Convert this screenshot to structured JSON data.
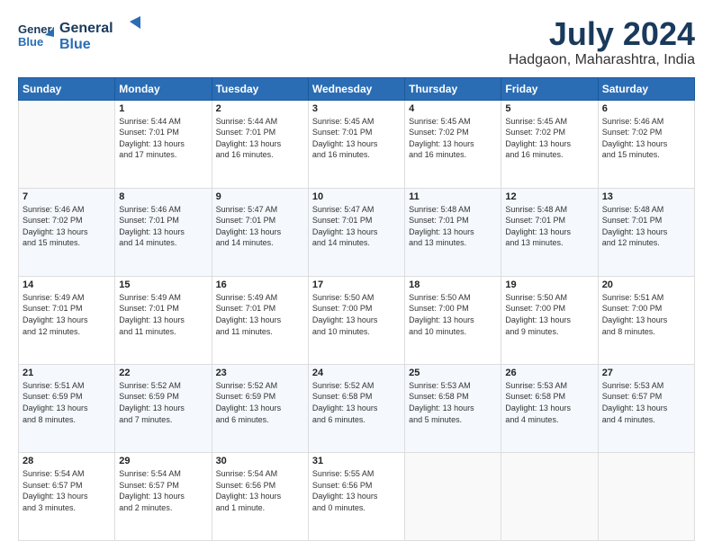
{
  "header": {
    "logo": {
      "line1": "General",
      "line2": "Blue"
    },
    "title": "July 2024",
    "location": "Hadgaon, Maharashtra, India"
  },
  "days_of_week": [
    "Sunday",
    "Monday",
    "Tuesday",
    "Wednesday",
    "Thursday",
    "Friday",
    "Saturday"
  ],
  "weeks": [
    [
      {
        "day": "",
        "info": ""
      },
      {
        "day": "1",
        "info": "Sunrise: 5:44 AM\nSunset: 7:01 PM\nDaylight: 13 hours\nand 17 minutes."
      },
      {
        "day": "2",
        "info": "Sunrise: 5:44 AM\nSunset: 7:01 PM\nDaylight: 13 hours\nand 16 minutes."
      },
      {
        "day": "3",
        "info": "Sunrise: 5:45 AM\nSunset: 7:01 PM\nDaylight: 13 hours\nand 16 minutes."
      },
      {
        "day": "4",
        "info": "Sunrise: 5:45 AM\nSunset: 7:02 PM\nDaylight: 13 hours\nand 16 minutes."
      },
      {
        "day": "5",
        "info": "Sunrise: 5:45 AM\nSunset: 7:02 PM\nDaylight: 13 hours\nand 16 minutes."
      },
      {
        "day": "6",
        "info": "Sunrise: 5:46 AM\nSunset: 7:02 PM\nDaylight: 13 hours\nand 15 minutes."
      }
    ],
    [
      {
        "day": "7",
        "info": "Sunrise: 5:46 AM\nSunset: 7:02 PM\nDaylight: 13 hours\nand 15 minutes."
      },
      {
        "day": "8",
        "info": "Sunrise: 5:46 AM\nSunset: 7:01 PM\nDaylight: 13 hours\nand 14 minutes."
      },
      {
        "day": "9",
        "info": "Sunrise: 5:47 AM\nSunset: 7:01 PM\nDaylight: 13 hours\nand 14 minutes."
      },
      {
        "day": "10",
        "info": "Sunrise: 5:47 AM\nSunset: 7:01 PM\nDaylight: 13 hours\nand 14 minutes."
      },
      {
        "day": "11",
        "info": "Sunrise: 5:48 AM\nSunset: 7:01 PM\nDaylight: 13 hours\nand 13 minutes."
      },
      {
        "day": "12",
        "info": "Sunrise: 5:48 AM\nSunset: 7:01 PM\nDaylight: 13 hours\nand 13 minutes."
      },
      {
        "day": "13",
        "info": "Sunrise: 5:48 AM\nSunset: 7:01 PM\nDaylight: 13 hours\nand 12 minutes."
      }
    ],
    [
      {
        "day": "14",
        "info": "Sunrise: 5:49 AM\nSunset: 7:01 PM\nDaylight: 13 hours\nand 12 minutes."
      },
      {
        "day": "15",
        "info": "Sunrise: 5:49 AM\nSunset: 7:01 PM\nDaylight: 13 hours\nand 11 minutes."
      },
      {
        "day": "16",
        "info": "Sunrise: 5:49 AM\nSunset: 7:01 PM\nDaylight: 13 hours\nand 11 minutes."
      },
      {
        "day": "17",
        "info": "Sunrise: 5:50 AM\nSunset: 7:00 PM\nDaylight: 13 hours\nand 10 minutes."
      },
      {
        "day": "18",
        "info": "Sunrise: 5:50 AM\nSunset: 7:00 PM\nDaylight: 13 hours\nand 10 minutes."
      },
      {
        "day": "19",
        "info": "Sunrise: 5:50 AM\nSunset: 7:00 PM\nDaylight: 13 hours\nand 9 minutes."
      },
      {
        "day": "20",
        "info": "Sunrise: 5:51 AM\nSunset: 7:00 PM\nDaylight: 13 hours\nand 8 minutes."
      }
    ],
    [
      {
        "day": "21",
        "info": "Sunrise: 5:51 AM\nSunset: 6:59 PM\nDaylight: 13 hours\nand 8 minutes."
      },
      {
        "day": "22",
        "info": "Sunrise: 5:52 AM\nSunset: 6:59 PM\nDaylight: 13 hours\nand 7 minutes."
      },
      {
        "day": "23",
        "info": "Sunrise: 5:52 AM\nSunset: 6:59 PM\nDaylight: 13 hours\nand 6 minutes."
      },
      {
        "day": "24",
        "info": "Sunrise: 5:52 AM\nSunset: 6:58 PM\nDaylight: 13 hours\nand 6 minutes."
      },
      {
        "day": "25",
        "info": "Sunrise: 5:53 AM\nSunset: 6:58 PM\nDaylight: 13 hours\nand 5 minutes."
      },
      {
        "day": "26",
        "info": "Sunrise: 5:53 AM\nSunset: 6:58 PM\nDaylight: 13 hours\nand 4 minutes."
      },
      {
        "day": "27",
        "info": "Sunrise: 5:53 AM\nSunset: 6:57 PM\nDaylight: 13 hours\nand 4 minutes."
      }
    ],
    [
      {
        "day": "28",
        "info": "Sunrise: 5:54 AM\nSunset: 6:57 PM\nDaylight: 13 hours\nand 3 minutes."
      },
      {
        "day": "29",
        "info": "Sunrise: 5:54 AM\nSunset: 6:57 PM\nDaylight: 13 hours\nand 2 minutes."
      },
      {
        "day": "30",
        "info": "Sunrise: 5:54 AM\nSunset: 6:56 PM\nDaylight: 13 hours\nand 1 minute."
      },
      {
        "day": "31",
        "info": "Sunrise: 5:55 AM\nSunset: 6:56 PM\nDaylight: 13 hours\nand 0 minutes."
      },
      {
        "day": "",
        "info": ""
      },
      {
        "day": "",
        "info": ""
      },
      {
        "day": "",
        "info": ""
      }
    ]
  ]
}
